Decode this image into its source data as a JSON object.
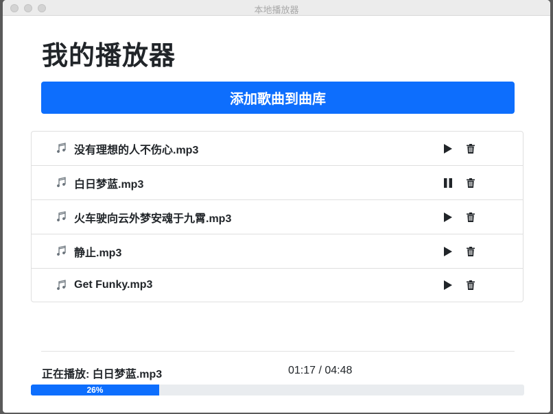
{
  "window": {
    "title": "本地播放器"
  },
  "page": {
    "title": "我的播放器"
  },
  "actions": {
    "add_label": "添加歌曲到曲库"
  },
  "songs": [
    {
      "name": "没有理想的人不伤心.mp3",
      "state": "play"
    },
    {
      "name": "白日梦蓝.mp3",
      "state": "pause"
    },
    {
      "name": "火车驶向云外梦安魂于九霄.mp3",
      "state": "play"
    },
    {
      "name": "静止.mp3",
      "state": "play"
    },
    {
      "name": "Get Funky.mp3",
      "state": "play"
    }
  ],
  "player": {
    "now_playing": "正在播放: 白日梦蓝.mp3",
    "time": "01:17 / 04:48",
    "progress_label": "26%",
    "progress_value": 0.26
  },
  "colors": {
    "accent": "#0d6efd",
    "progress_track": "#e9ecef"
  },
  "icons": {
    "song": "music-note-icon",
    "play": "play-icon",
    "pause": "pause-icon",
    "delete": "trash-icon"
  }
}
